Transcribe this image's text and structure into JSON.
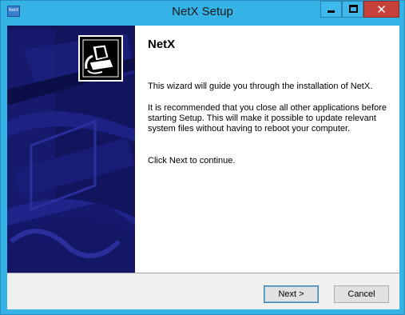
{
  "window": {
    "title": "NetX Setup",
    "app_icon_text": "NetX",
    "minimize_icon": "minimize-icon",
    "maximize_icon": "maximize-icon",
    "close_icon": "close-icon"
  },
  "content": {
    "heading": "NetX",
    "paragraph1": "This wizard will guide you through the installation of NetX.",
    "paragraph2": "It is recommended that you close all other applications before starting Setup. This will make it possible to update relevant system files without having to reboot your computer.",
    "paragraph3": "Click Next to continue."
  },
  "buttons": {
    "next_label": "Next >",
    "cancel_label": "Cancel"
  },
  "colors": {
    "titlebar": "#35b2e6",
    "banner": "#12145e",
    "close_button": "#c7413b"
  }
}
